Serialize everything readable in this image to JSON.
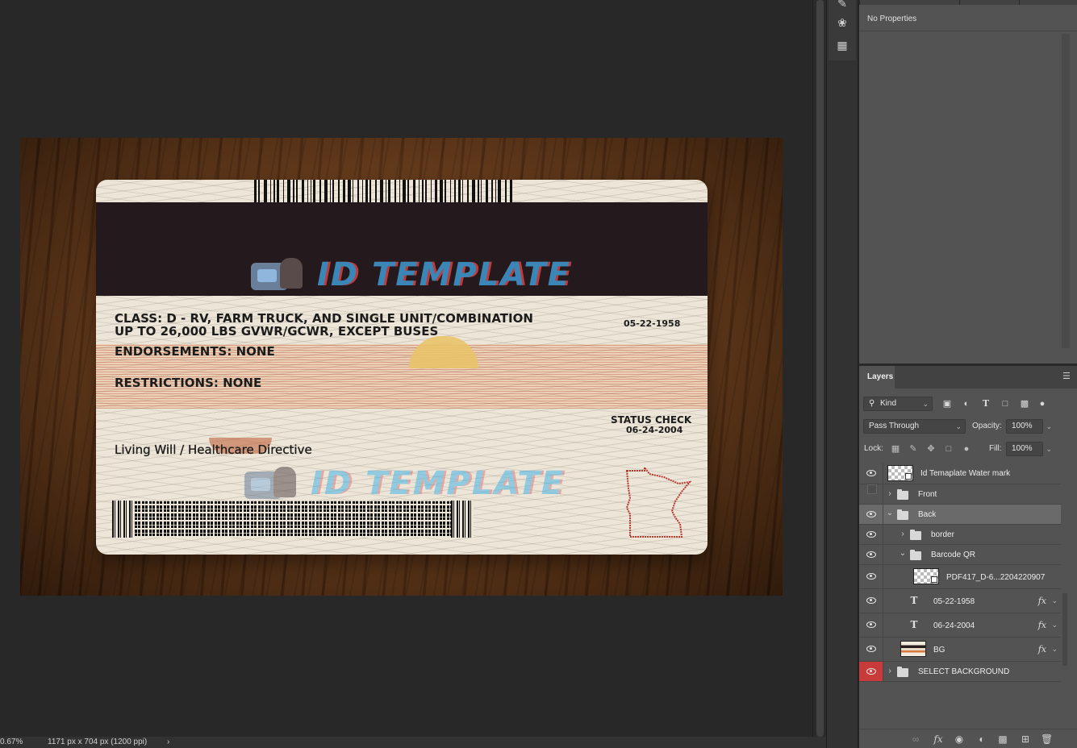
{
  "document": {
    "card": {
      "watermark_text": "ID TEMPLATE",
      "class_line1": "CLASS: D - RV, FARM TRUCK, AND SINGLE UNIT/COMBINATION",
      "class_line2": "UP TO 26,000 LBS GVWR/GCWR, EXCEPT BUSES",
      "endorsements": "ENDORSEMENTS: NONE",
      "restrictions": "RESTRICTIONS: NONE",
      "date_of_birth": "05-22-1958",
      "status_label": "STATUS CHECK",
      "status_date": "06-24-2004",
      "living_will": "Living Will / Healthcare Directive"
    }
  },
  "status_bar": {
    "zoom": "0.67%",
    "doc_size": "1171 px x 704 px (1200 ppi)",
    "arrow": "›"
  },
  "tools": {
    "icons": [
      "brush-settings-icon",
      "palette-icon",
      "grid-table-icon"
    ]
  },
  "properties": {
    "message": "No Properties"
  },
  "layers": {
    "tab_label": "Layers",
    "filter_kind": "Kind",
    "blend_mode": "Pass Through",
    "opacity_label": "Opacity:",
    "opacity_value": "100%",
    "lock_label": "Lock:",
    "fill_label": "Fill:",
    "fill_value": "100%",
    "rows": [
      {
        "name": "Id Temaplate Water mark",
        "type": "smart"
      },
      {
        "name": "Front",
        "type": "group"
      },
      {
        "name": "Back",
        "type": "group"
      },
      {
        "name": "border",
        "type": "group"
      },
      {
        "name": "Barcode QR",
        "type": "group"
      },
      {
        "name": "PDF417_D-6...2204220907",
        "type": "smart"
      },
      {
        "name": "05-22-1958",
        "type": "text"
      },
      {
        "name": "06-24-2004",
        "type": "text"
      },
      {
        "name": "BG",
        "type": "image"
      },
      {
        "name": "SELECT BACKGROUND",
        "type": "group"
      }
    ]
  }
}
